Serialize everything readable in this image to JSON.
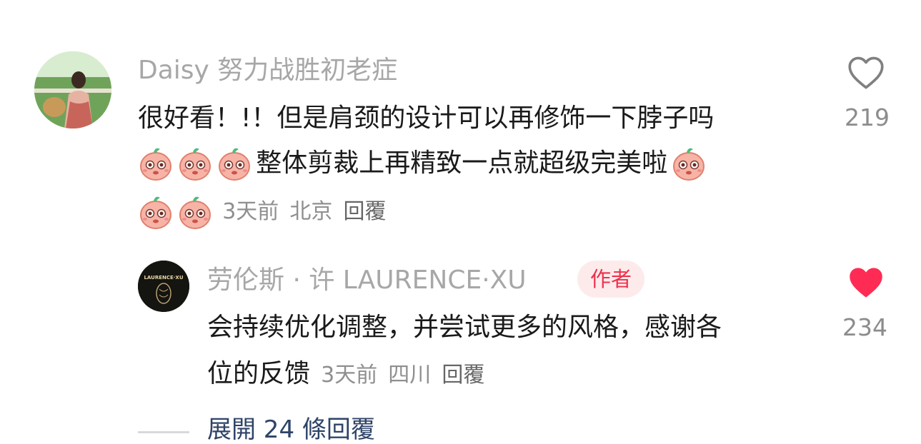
{
  "comment": {
    "username": "Daisy 努力战胜初老症",
    "text_line1": "很好看！!！但是肩颈的设计可以再修饰一下脖子吗",
    "text_line2": "整体剪裁上再精致一点就超级完美啦",
    "time": "3天前",
    "location": "北京",
    "reply_label": "回覆",
    "like_count": "219",
    "liked": false
  },
  "reply": {
    "username": "劳伦斯 · 许 LAURENCE·XU",
    "author_badge": "作者",
    "avatar_text": "LAURENCE·XU",
    "text_line1": "会持续优化调整，并尝试更多的风格，感谢各",
    "text_line2": "位的反馈",
    "time": "3天前",
    "location": "四川",
    "reply_label": "回覆",
    "like_count": "234",
    "liked": true
  },
  "expand_replies": "展開 24 條回覆",
  "colors": {
    "like_active": "#fe2c55",
    "badge_bg": "#fdebeb",
    "badge_text": "#ef2f4d"
  },
  "icons": {
    "sticker": "crying-face-sticker",
    "like": "heart-icon"
  }
}
